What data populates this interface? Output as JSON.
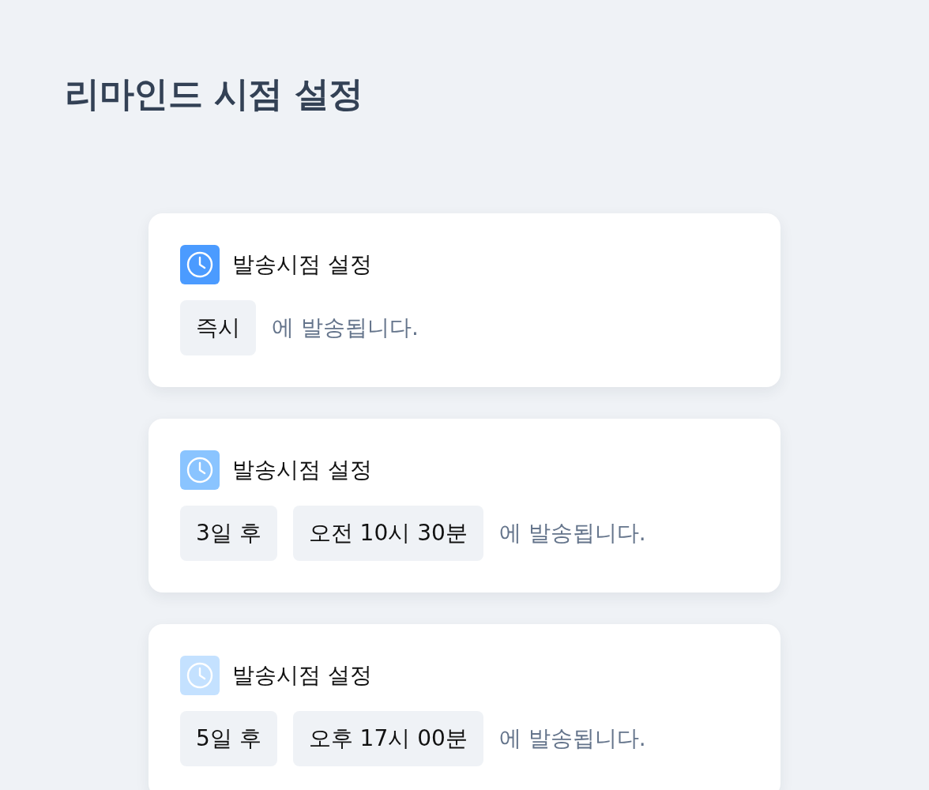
{
  "title": "리마인드 시점 설정",
  "cards": [
    {
      "heading": "발송시점 설정",
      "color": "#4b9bff",
      "chips": [
        "즉시"
      ],
      "suffix": "에 발송됩니다."
    },
    {
      "heading": "발송시점 설정",
      "color": "#8ac4ff",
      "chips": [
        "3일 후",
        "오전 10시 30분"
      ],
      "suffix": "에 발송됩니다."
    },
    {
      "heading": "발송시점 설정",
      "color": "#c4e1ff",
      "chips": [
        "5일 후",
        "오후 17시 00분"
      ],
      "suffix": "에 발송됩니다."
    }
  ]
}
